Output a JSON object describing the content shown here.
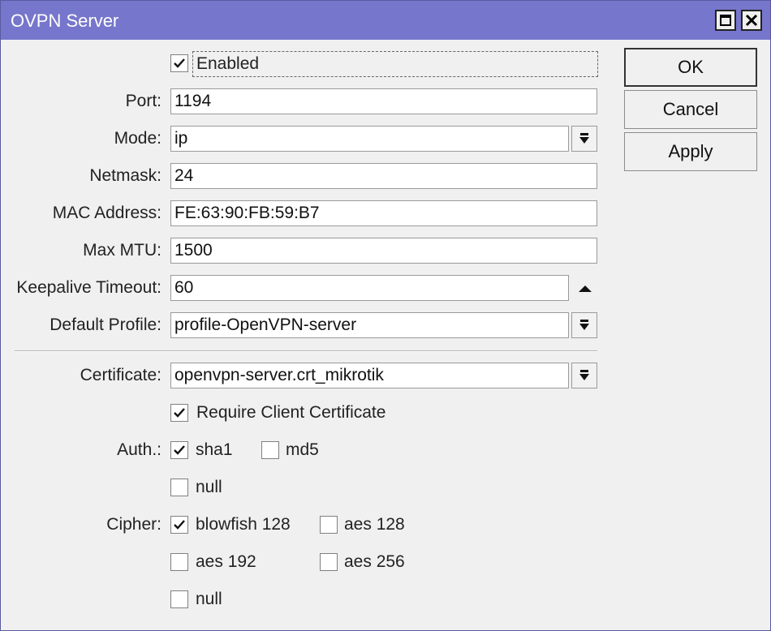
{
  "window": {
    "title": "OVPN Server"
  },
  "general": {
    "enabled_label": "Enabled",
    "enabled_checked": true,
    "port_label": "Port:",
    "port": "1194",
    "mode_label": "Mode:",
    "mode": "ip",
    "netmask_label": "Netmask:",
    "netmask": "24",
    "mac_label": "MAC Address:",
    "mac": "FE:63:90:FB:59:B7",
    "mtu_label": "Max MTU:",
    "mtu": "1500",
    "keepalive_label": "Keepalive Timeout:",
    "keepalive": "60",
    "profile_label": "Default Profile:",
    "profile": "profile-OpenVPN-server"
  },
  "security": {
    "certificate_label": "Certificate:",
    "certificate": "openvpn-server.crt_mikrotik",
    "require_cert_label": "Require Client Certificate",
    "require_cert_checked": true,
    "auth_label": "Auth.:",
    "auth_options": [
      {
        "label": "sha1",
        "checked": true
      },
      {
        "label": "md5",
        "checked": false
      },
      {
        "label": "null",
        "checked": false
      }
    ],
    "cipher_label": "Cipher:",
    "cipher_options": [
      {
        "label": "blowfish 128",
        "checked": true
      },
      {
        "label": "aes 128",
        "checked": false
      },
      {
        "label": "aes 192",
        "checked": false
      },
      {
        "label": "aes 256",
        "checked": false
      },
      {
        "label": "null",
        "checked": false
      }
    ]
  },
  "buttons": {
    "ok": "OK",
    "cancel": "Cancel",
    "apply": "Apply"
  },
  "colors": {
    "titlebar": "#7676cc",
    "window_bg": "#f0f0f0"
  },
  "icons": {
    "maximize": "maximize-icon",
    "close": "close-icon",
    "dropdown": "dropdown-arrow-icon",
    "collapse": "collapse-up-icon",
    "check": "checkmark-icon"
  }
}
